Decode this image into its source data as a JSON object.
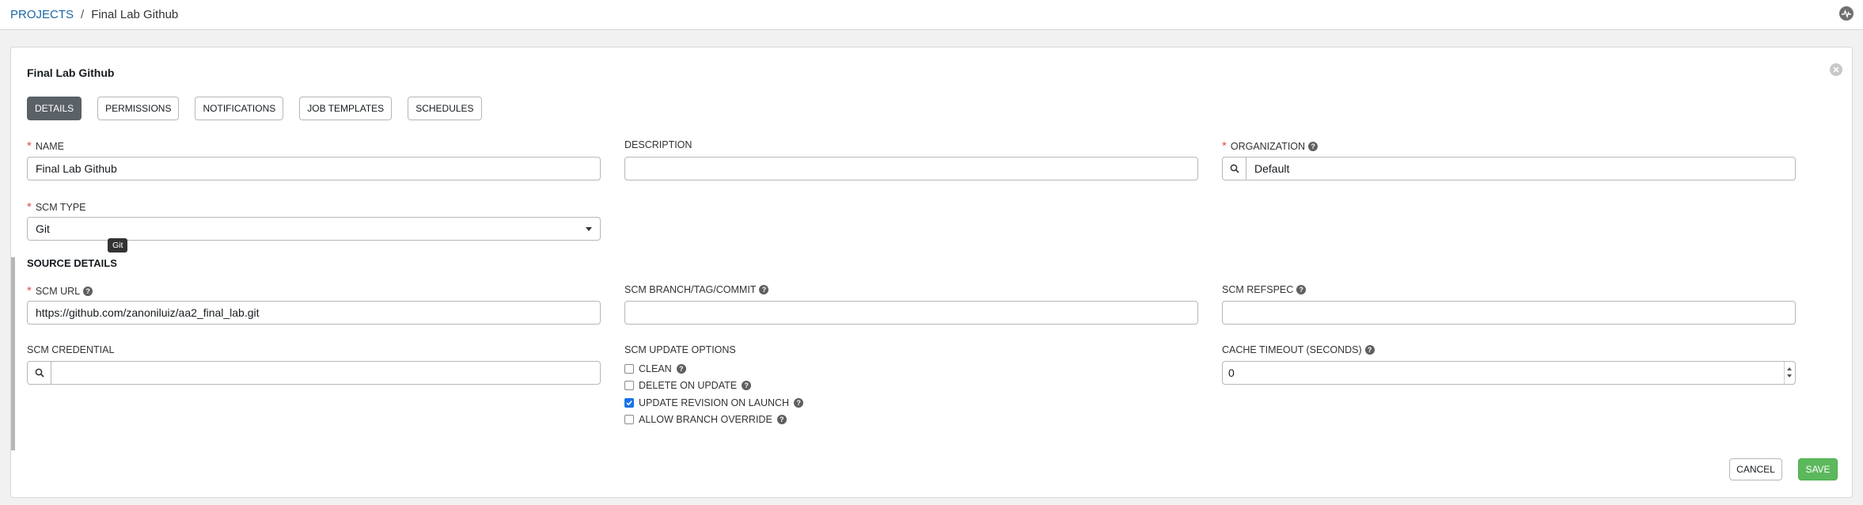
{
  "breadcrumb": {
    "parent": "PROJECTS",
    "separator": "/",
    "current": "Final Lab Github"
  },
  "panel": {
    "title": "Final Lab Github"
  },
  "tabs": [
    {
      "label": "DETAILS",
      "active": true
    },
    {
      "label": "PERMISSIONS",
      "active": false
    },
    {
      "label": "NOTIFICATIONS",
      "active": false
    },
    {
      "label": "JOB TEMPLATES",
      "active": false
    },
    {
      "label": "SCHEDULES",
      "active": false
    }
  ],
  "form": {
    "required_mark": "*",
    "help_glyph": "?",
    "name": {
      "label": "NAME",
      "value": "Final Lab Github"
    },
    "description": {
      "label": "DESCRIPTION",
      "value": ""
    },
    "organization": {
      "label": "ORGANIZATION",
      "value": "Default"
    },
    "scm_type": {
      "label": "SCM TYPE",
      "value": "Git",
      "tooltip": "Git"
    },
    "source_details": {
      "title": "SOURCE DETAILS"
    },
    "scm_url": {
      "label": "SCM URL",
      "value": "https://github.com/zanoniluiz/aa2_final_lab.git"
    },
    "scm_branch": {
      "label": "SCM BRANCH/TAG/COMMIT",
      "value": ""
    },
    "scm_refspec": {
      "label": "SCM REFSPEC",
      "value": ""
    },
    "scm_credential": {
      "label": "SCM CREDENTIAL",
      "value": ""
    },
    "scm_update_options": {
      "label": "SCM UPDATE OPTIONS",
      "options": [
        {
          "label": "CLEAN",
          "checked": false
        },
        {
          "label": "DELETE ON UPDATE",
          "checked": false
        },
        {
          "label": "UPDATE REVISION ON LAUNCH",
          "checked": true
        },
        {
          "label": "ALLOW BRANCH OVERRIDE",
          "checked": false
        }
      ]
    },
    "cache_timeout": {
      "label": "CACHE TIMEOUT (SECONDS)",
      "value": "0"
    }
  },
  "actions": {
    "cancel": "CANCEL",
    "save": "SAVE"
  },
  "colors": {
    "link": "#1a68a6",
    "required": "#d9534f",
    "save": "#5cb85c",
    "active_tab": "#5a6167",
    "checkbox_checked": "#1a73e8"
  }
}
